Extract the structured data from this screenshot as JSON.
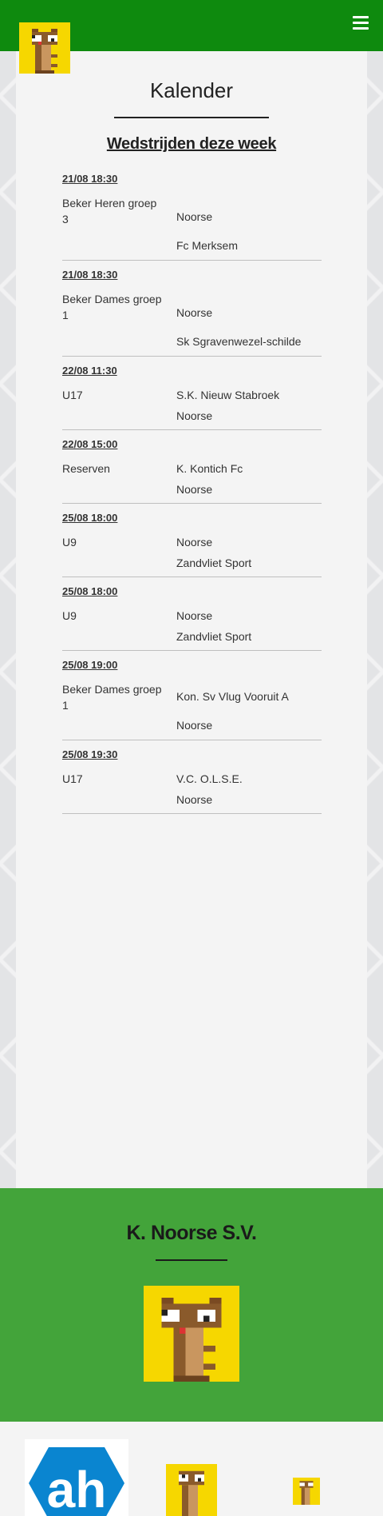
{
  "header": {
    "logo_icon": "bear-mascot-icon",
    "menu_icon": "hamburger-menu-icon",
    "brand_color": "#0e8a0e"
  },
  "page": {
    "title": "Kalender",
    "section_title": "Wedstrijden deze week"
  },
  "matches": [
    {
      "datetime": "21/08 18:30",
      "competition": "Beker Heren groep 3",
      "home": "Noorse",
      "away": "Fc Merksem"
    },
    {
      "datetime": "21/08 18:30",
      "competition": "Beker Dames groep 1",
      "home": "Noorse",
      "away": "Sk Sgravenwezel-schilde"
    },
    {
      "datetime": "22/08 11:30",
      "competition": "U17",
      "home": "S.K. Nieuw Stabroek",
      "away": "Noorse"
    },
    {
      "datetime": "22/08 15:00",
      "competition": "Reserven",
      "home": "K. Kontich Fc",
      "away": "Noorse"
    },
    {
      "datetime": "25/08 18:00",
      "competition": "U9",
      "home": "Noorse",
      "away": "Zandvliet Sport"
    },
    {
      "datetime": "25/08 18:00",
      "competition": "U9",
      "home": "Noorse",
      "away": "Zandvliet Sport"
    },
    {
      "datetime": "25/08 19:00",
      "competition": "Beker Dames groep 1",
      "home": "Kon. Sv Vlug Vooruit A",
      "away": "Noorse"
    },
    {
      "datetime": "25/08 19:30",
      "competition": "U17",
      "home": "V.C. O.L.S.E.",
      "away": "Noorse"
    }
  ],
  "footer": {
    "club_name": "K. Noorse S.V.",
    "logo_icon": "bear-mascot-icon",
    "footer_color": "#43a43a"
  },
  "sponsors": {
    "items": [
      "ah-logo-icon",
      "bear-mascot-icon",
      "bear-mascot-icon"
    ]
  }
}
